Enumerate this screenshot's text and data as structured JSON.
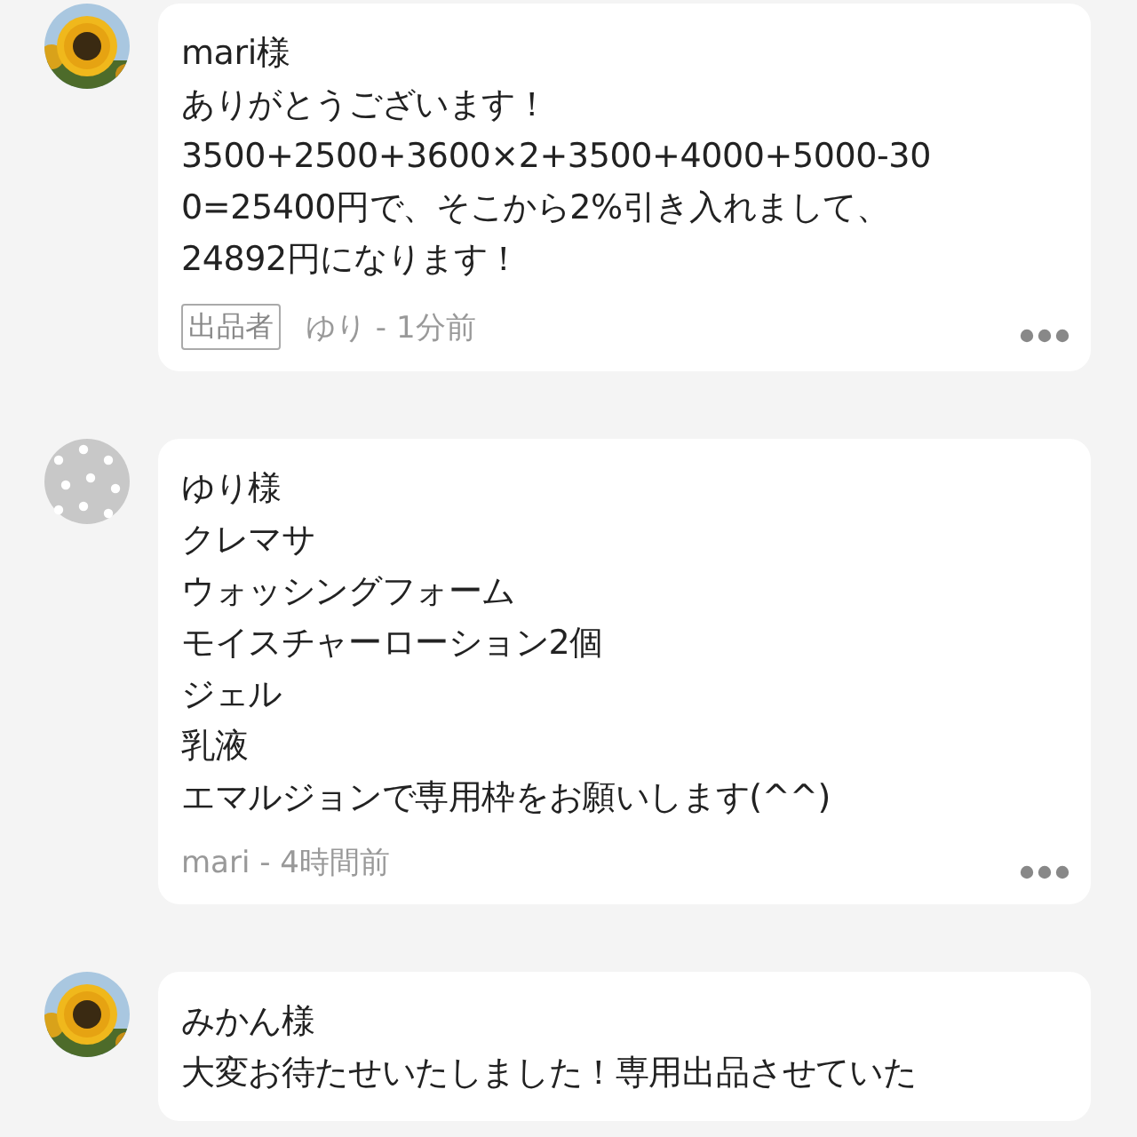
{
  "comments": [
    {
      "avatar": {
        "kind": "picture"
      },
      "lines": [
        "mari様",
        "ありがとうございます！",
        "3500+2500+3600×2+3500+4000+5000-30",
        "0=25400円で、そこから2%引き入れまして、",
        "24892円になります！"
      ],
      "badge": "出品者",
      "meta": "ゆり - 1分前"
    },
    {
      "avatar": {
        "kind": "pattern"
      },
      "lines": [
        "ゆり様",
        "クレマサ",
        "ウォッシングフォーム",
        "モイスチャーローション2個",
        "ジェル",
        "乳液",
        "エマルジョンで専用枠をお願いします(^^)"
      ],
      "meta": "mari - 4時間前"
    },
    {
      "avatar": {
        "kind": "picture"
      },
      "lines": [
        "みかん様",
        "大変お待たせいたしました！専用出品させていた"
      ]
    }
  ]
}
